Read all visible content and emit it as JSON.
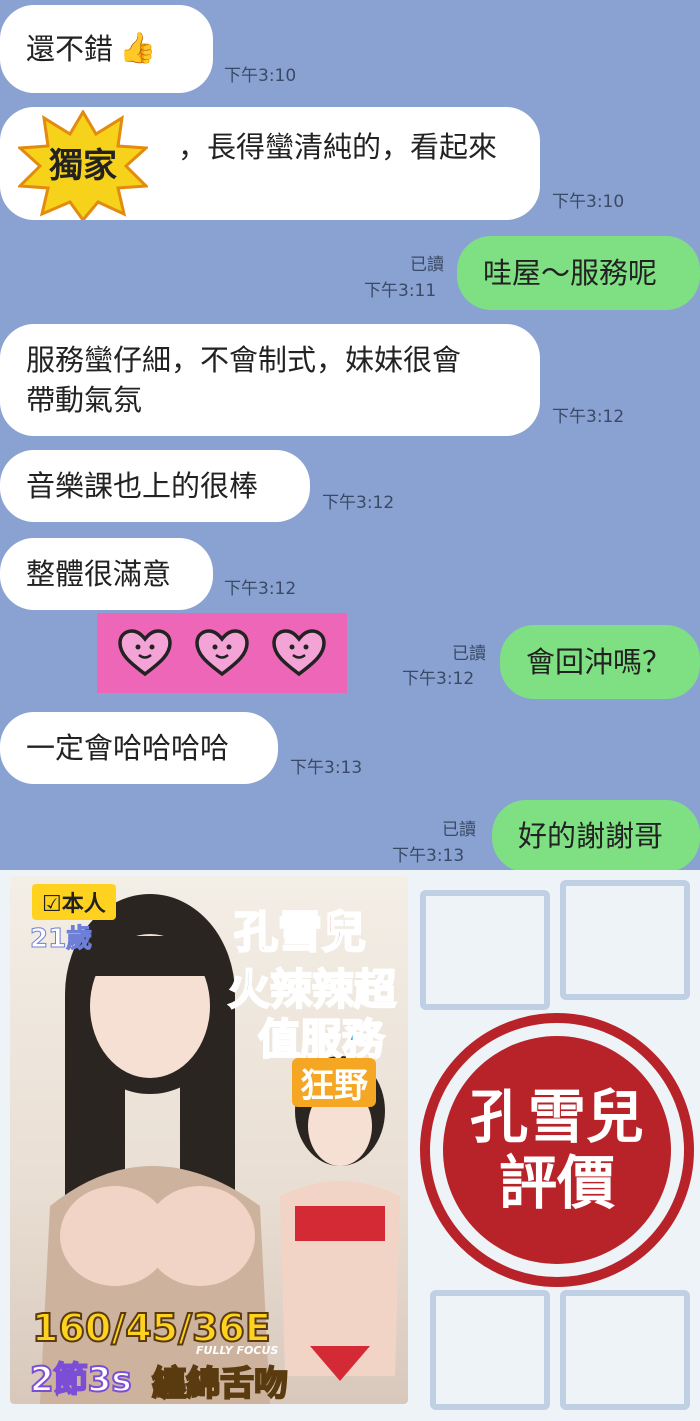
{
  "chat": {
    "messages": [
      {
        "text": "還不錯",
        "emoji": "👍",
        "time": "下午3:10"
      },
      {
        "text_line1": "，長得蠻清純的，看起來",
        "time": "下午3:10",
        "badge": "獨家"
      },
      {
        "text": "哇屋～服務呢",
        "read": "已讀",
        "time": "下午3:11"
      },
      {
        "text_line1": "服務蠻仔細，不會制式，妹妹很會",
        "text_line2": "帶動氣氛",
        "time": "下午3:12"
      },
      {
        "text": "音樂課也上的很棒",
        "time": "下午3:12"
      },
      {
        "text": "整體很滿意",
        "time": "下午3:12"
      },
      {
        "text": "會回沖嗎？",
        "read": "已讀",
        "time": "下午3:12"
      },
      {
        "text": "一定會哈哈哈哈",
        "time": "下午3:13"
      },
      {
        "text": "好的謝謝哥",
        "read": "已讀",
        "time": "下午3:13"
      }
    ]
  },
  "promo": {
    "verified": "☑本人",
    "age": "21歲",
    "name": "孔雪兒",
    "tagline1": "火辣辣超",
    "tagline2": "值服務",
    "wild": "狂野",
    "stats": "160/45/36E",
    "session": "2節3s",
    "focus": "FULLY FOCUS",
    "kiss": "纏綿舌吻",
    "stamp_line1": "孔雪兒",
    "stamp_line2": "評價"
  },
  "colors": {
    "chat_bg": "#8aa2d2",
    "incoming": "#ffffff",
    "outgoing": "#7fe083",
    "sticker": "#ee66b8",
    "stamp_red": "#b8232a"
  }
}
